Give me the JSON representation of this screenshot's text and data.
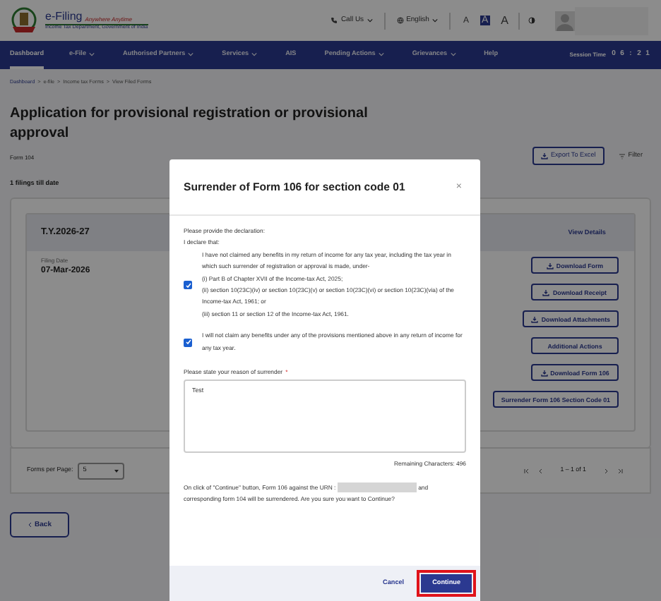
{
  "header": {
    "logo_title": "e-Filing",
    "logo_tagline": "Anywhere Anytime",
    "logo_subtitle": "Income Tax Department, Government of India",
    "call_us": "Call Us",
    "language": "English",
    "text_size": [
      {
        "label": "A",
        "kind": "decrease",
        "selected": false
      },
      {
        "label": "A",
        "kind": "reset",
        "selected": true
      },
      {
        "label": "A",
        "kind": "increase",
        "selected": false
      }
    ]
  },
  "nav": {
    "items": [
      {
        "label": "Dashboard",
        "dropdown": false,
        "selected": true
      },
      {
        "label": "e-File",
        "dropdown": true,
        "selected": false
      },
      {
        "label": "Authorised Partners",
        "dropdown": true,
        "selected": false
      },
      {
        "label": "Services",
        "dropdown": true,
        "selected": false
      },
      {
        "label": "AIS",
        "dropdown": false,
        "selected": false
      },
      {
        "label": "Pending Actions",
        "dropdown": true,
        "selected": false
      },
      {
        "label": "Grievances",
        "dropdown": true,
        "selected": false
      },
      {
        "label": "Help",
        "dropdown": false,
        "selected": false
      }
    ],
    "session_label": "Session Time",
    "session_digits": [
      "0",
      "6",
      ":",
      "2",
      "1"
    ]
  },
  "breadcrumb": {
    "separator": ">",
    "items": [
      "Dashboard",
      "e-file",
      "Income tax Forms",
      "View Filed Forms"
    ]
  },
  "page": {
    "title": "Application for provisional registration or provisional approval",
    "form_label": "Form 104",
    "count": "1 filings till date",
    "export_button": "Export To Excel",
    "filter_button": "Filter"
  },
  "card": {
    "tax_year": "T.Y.2026-27",
    "view_details": "View Details",
    "filing_date_label": "Filing Date",
    "filing_date": "07-Mar-2026",
    "actions": [
      {
        "label": "Download Form",
        "icon": true
      },
      {
        "label": "Download Receipt",
        "icon": true
      },
      {
        "label": "Download Attachments",
        "icon": true
      },
      {
        "label": "Additional Actions",
        "icon": false
      },
      {
        "label": "Download Form 106",
        "icon": true
      },
      {
        "label": "Surrender Form 106 Section Code 01",
        "icon": false
      }
    ]
  },
  "pagination": {
    "label": "Forms per Page:",
    "value": "5",
    "range": "1 – 1 of 1"
  },
  "back_button": "Back",
  "modal": {
    "title": "Surrender of Form 106 for section code 01",
    "close": "×",
    "intro": [
      "Please provide the declaration:",
      "I declare that:"
    ],
    "declarations": [
      {
        "checked": true,
        "lines": [
          "I have not claimed any benefits in my return of income for any tax year, including the tax year in which such surrender of registration or approval is made, under-",
          "(i) Part B of Chapter XVII of the Income-tax Act, 2025;",
          "(ii) section 10(23C)(iv) or section 10(23C)(v) or section 10(23C)(vi) or section 10(23C)(via) of the Income-tax Act, 1961; or",
          "(iii) section 11 or section 12 of the Income-tax Act, 1961."
        ]
      },
      {
        "checked": true,
        "lines": [
          "I will not claim any benefits under any of the provisions mentioned above in any return of income for any tax year."
        ]
      }
    ],
    "reason_label": "Please state your reason of surrender",
    "required_marker": "*",
    "reason_value": "Test",
    "remaining": "Remaining Characters: 496",
    "confirm_before": "On click of \"Continue\" button, Form 106 against the URN :",
    "confirm_after": "and corresponding form 104 will be surrendered. Are you sure you want to Continue?",
    "cancel_button": "Cancel",
    "continue_button": "Continue",
    "continue_highlighted": true
  }
}
